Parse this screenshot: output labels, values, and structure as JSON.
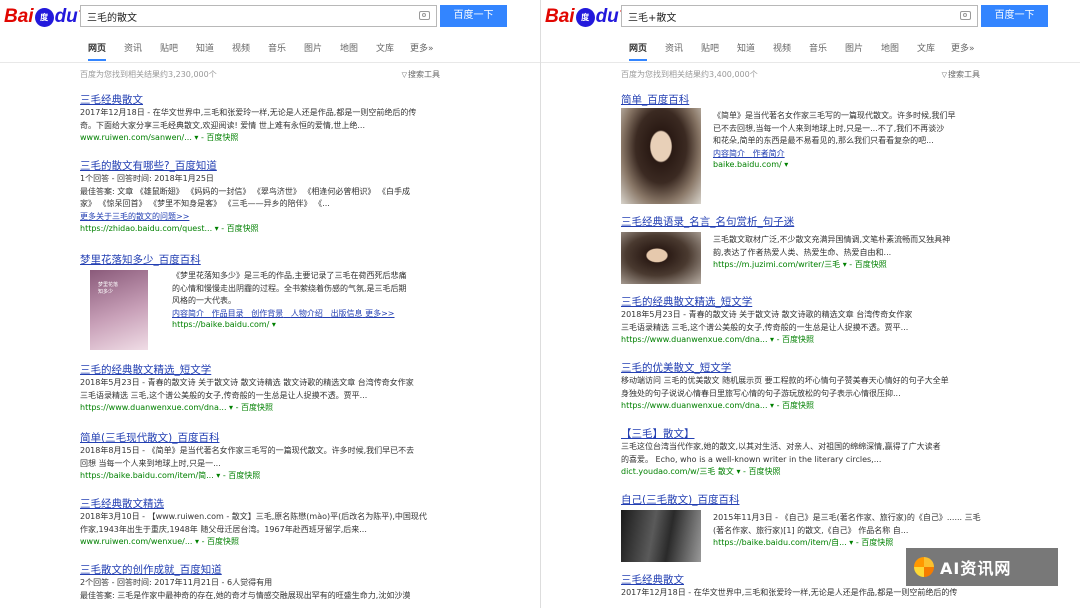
{
  "logo": {
    "bai": "Bai",
    "du": "du",
    "paw": "度",
    "name": "百度"
  },
  "search_button": "百度一下",
  "tools_label": "搜索工具",
  "left": {
    "query": "三毛的散文",
    "tabs": [
      "网页",
      "资讯",
      "贴吧",
      "知道",
      "视频",
      "音乐",
      "图片",
      "地图",
      "文库",
      "更多»"
    ],
    "stats": "百度为您找到相关结果约3,230,000个",
    "results": [
      {
        "title": "三毛经典散文",
        "text": [
          "2017年12月18日 - 在华文世界中,三毛和张爱玲一样,无论是人还是作品,都是一则空前绝后的传",
          "奇。下面给大家分享三毛经典散文,欢迎阅读! 爱情 世上难有永恒的爱情,世上绝..."
        ],
        "url": "www.ruiwen.com/sanwen/...  ▾ - 百度快照"
      },
      {
        "title": "三毛的散文有哪些?_百度知道",
        "text": [
          "1个回答 - 回答时间: 2018年1月25日",
          "最佳答案: 文章 《雄鼠断翅》 《妈妈的一封信》 《翠鸟济世》 《相逢何必曾相识》 《白手成",
          "家》 《惊呆回首》 《梦里不知身是客》 《三毛——异乡的陪伴》 《..."
        ],
        "more": "更多关于三毛的散文的问题>>",
        "url": "https://zhidao.baidu.com/quest...  ▾ - 百度快照"
      },
      {
        "title": "梦里花落知多少_百度百科",
        "text": [
          "《梦里花落知多少》是三毛的作品,主要记录了三毛在荷西死后悲痛",
          "的心情和慢慢走出阴霾的过程。全书萦绕着伤感的气氛,是三毛后期",
          "风格的一大代表。"
        ],
        "links": [
          "内容简介",
          "作品目录",
          "创作背景",
          "人物介绍",
          "出版信息",
          "更多>>"
        ],
        "url": "https://baike.baidu.com/  ▾",
        "thumb_text": "梦里花落知多少"
      },
      {
        "title": "三毛的经典散文精选_短文学",
        "text": [
          "2018年5月23日 - 青春的散文诗 关于散文诗 散文诗精选 散文诗歌的精选文章 台湾传奇女作家",
          "三毛语录精选 三毛,这个谱公美般的女子,传奇般的一生总是让人捉摸不透。贾平..."
        ],
        "url": "https://www.duanwenxue.com/dna...  ▾ - 百度快照"
      },
      {
        "title": "简单(三毛现代散文)_百度百科",
        "text": [
          "2018年8月15日 - 《简单》是当代著名女作家三毛写的一篇现代散文。许多时候,我们早已不去",
          "回想 当每一个人来到地球上时,只是一..."
        ],
        "url": "https://baike.baidu.com/item/简...  ▾ - 百度快照"
      },
      {
        "title": "三毛经典散文精选",
        "text": [
          "2018年3月10日 - 【www.ruiwen.com - 散文】三毛,原名陈懋(mào)平(后改名为陈平),中国现代",
          "作家,1943年出生于重庆,1948年 随父母迁居台湾。1967年赴西班牙留学,后来..."
        ],
        "url": "www.ruiwen.com/wenxue/...  ▾ - 百度快照"
      },
      {
        "title": "三毛散文的创作成就_百度知道",
        "text": [
          "2个回答 - 回答时间: 2017年11月21日 - 6人觉得有用",
          "最佳答案: 三毛是作家中最神奇的存在,她的奇才与情感交融展现出罕有的旺盛生命力,沈如沙漠"
        ],
        "url": ""
      }
    ]
  },
  "right": {
    "query": "三毛+散文",
    "tabs": [
      "网页",
      "资讯",
      "贴吧",
      "知道",
      "视频",
      "音乐",
      "图片",
      "地图",
      "文库",
      "更多»"
    ],
    "stats": "百度为您找到相关结果约3,400,000个",
    "results": [
      {
        "title": "简单_百度百科",
        "text": [
          "《简单》是当代著名女作家三毛写的一篇现代散文。许多时候,我们早",
          "已不去回想,当每一个人来到地球上时,只是一...不了,我们不再谈沙",
          "和花朵,简单的东西是最不易看见的,那么我们只看看复杂的吧..."
        ],
        "links": [
          "内容简介",
          "作者简介"
        ],
        "url": "baike.baidu.com/  ▾"
      },
      {
        "title": "三毛经典语录_名言_名句赏析_句子迷",
        "text": [
          "三毛散文取材广泛,不少散文充满异国情调,文笔朴素流畅而又独具神",
          "韵,表达了作者热爱人类、热爱生命、热爱自由和..."
        ],
        "url": "https://m.juzimi.com/writer/三毛  ▾ - 百度快照"
      },
      {
        "title": "三毛的经典散文精选_短文学",
        "text": [
          "2018年5月23日 - 青春的散文诗 关于散文诗 散文诗歌的精选文章 台湾传奇女作家",
          "三毛语录精选 三毛,这个谱公美般的女子,传奇般的一生总是让人捉摸不透。贾平..."
        ],
        "url": "https://www.duanwenxue.com/dna...  ▾ - 百度快照"
      },
      {
        "title": "三毛的优美散文_短文学",
        "text": [
          "移动端访问 三毛的优美散文 随机展示页 要工程款的坏心情句子赞美春天心情好的句子大全单",
          "身独处的句子说说心情春日里旅写心情的句子游玩放松的句子表示心情很压抑..."
        ],
        "url": "https://www.duanwenxue.com/dna...  ▾ - 百度快照"
      },
      {
        "title": "【三毛】散文】",
        "text": [
          "三毛这位台湾当代作家,她的散文,以其对生活、对亲人、对祖国的绵绵深情,赢得了广大读者",
          "的喜爱。 Echo, who is a well-known writer in the literary circles,..."
        ],
        "url": "dict.youdao.com/w/三毛 散文  ▾ - 百度快照"
      },
      {
        "title": "自己(三毛散文)_百度百科",
        "text": [
          "2015年11月3日 - 《自己》是三毛(著名作家、旅行家)的《自己》...... 三毛",
          "(著名作家、旅行家)[1] 的散文,《自己》 作品名称 自..."
        ],
        "url": "https://baike.baidu.com/item/自...  ▾ - 百度快照"
      },
      {
        "title": "三毛经典散文",
        "text": [
          "2017年12月18日 - 在华文世界中,三毛和张爱玲一样,无论是人还是作品,都是一则空前绝后的传"
        ],
        "url": ""
      }
    ]
  },
  "watermark": "AI资讯网",
  "colors": {
    "link": "#2440b3",
    "highlight": "#cc0000",
    "url": "#008000",
    "button": "#3385ff",
    "logo_red": "#e10601",
    "logo_blue": "#2319dc"
  }
}
